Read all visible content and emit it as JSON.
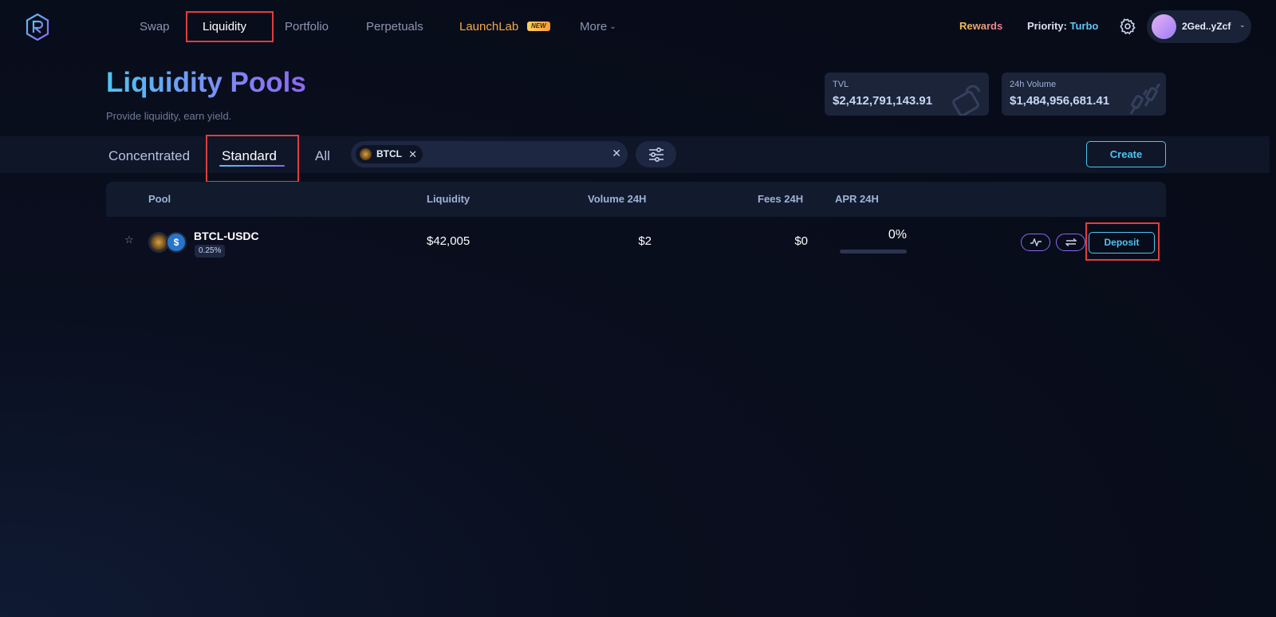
{
  "nav": {
    "items": [
      {
        "label": "Swap"
      },
      {
        "label": "Liquidity"
      },
      {
        "label": "Portfolio"
      },
      {
        "label": "Perpetuals"
      },
      {
        "label": "LaunchLab",
        "badge": "NEW"
      },
      {
        "label": "More"
      }
    ],
    "rewards": "Rewards",
    "priority_label": "Priority:",
    "priority_value": "Turbo",
    "wallet_address": "2Ged..yZcf"
  },
  "header": {
    "title": "Liquidity Pools",
    "subtitle": "Provide liquidity, earn yield.",
    "stats": [
      {
        "label": "TVL",
        "value": "$2,412,791,143.91"
      },
      {
        "label": "24h Volume",
        "value": "$1,484,956,681.41"
      }
    ]
  },
  "filters": {
    "tabs": [
      "Concentrated",
      "Standard",
      "All"
    ],
    "active_tab": "Standard",
    "search_chip": "BTCL",
    "create_label": "Create"
  },
  "table": {
    "columns": [
      "Pool",
      "Liquidity",
      "Volume 24H",
      "Fees 24H",
      "APR 24H"
    ],
    "rows": [
      {
        "pair": "BTCL-USDC",
        "fee_tier": "0.25%",
        "liquidity": "$42,005",
        "volume_24h": "$2",
        "fees_24h": "$0",
        "apr_24h": "0%",
        "action": "Deposit"
      }
    ]
  },
  "colors": {
    "accent": "#4fc4f0",
    "purple": "#8d66f2",
    "highlight": "#e23d3d",
    "launchlab": "#f6a94a"
  }
}
